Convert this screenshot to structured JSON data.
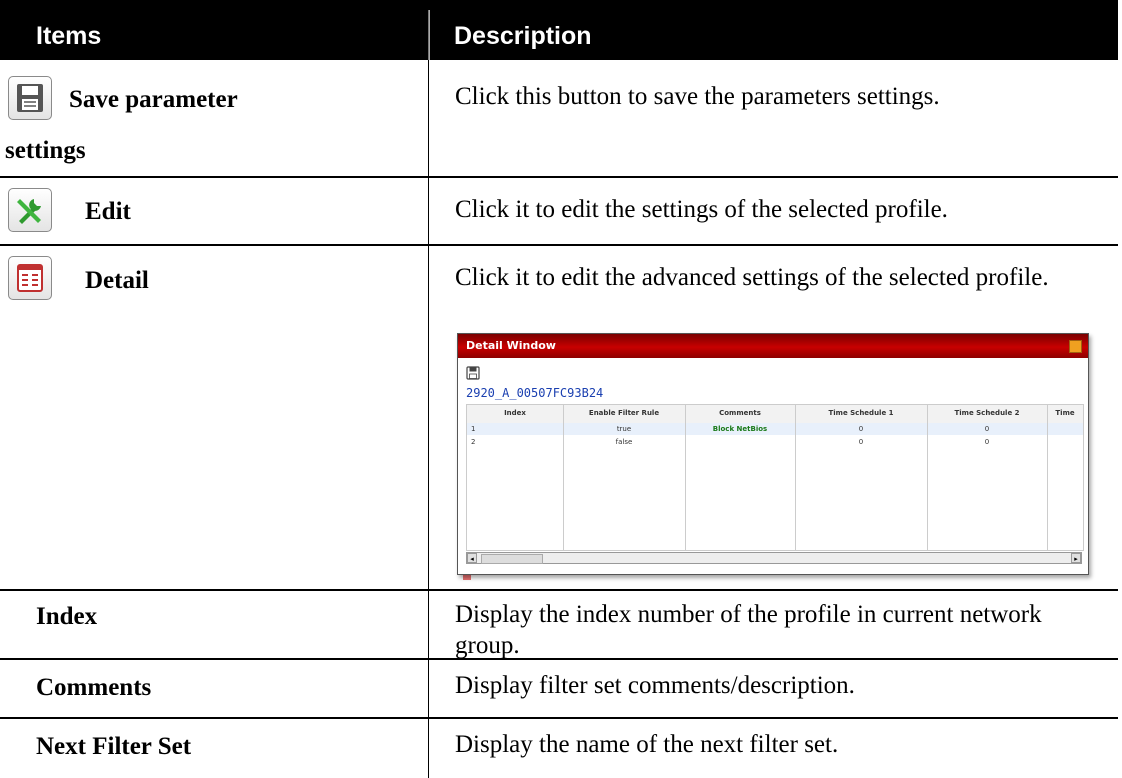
{
  "header": {
    "items": "Items",
    "description": "Description"
  },
  "rows": [
    {
      "item_line1": "Save parameter",
      "item_line2": "settings",
      "icon": "save-disk-icon",
      "desc": "Click this button to save the parameters settings."
    },
    {
      "item": "Edit",
      "icon": "tools-icon",
      "desc": "Click it to edit the settings of the selected profile."
    },
    {
      "item": "Detail",
      "icon": "detail-list-icon",
      "desc": "Click it to edit the advanced settings of the selected profile."
    },
    {
      "item": "Index",
      "desc": "Display the index number of the profile in current network group."
    },
    {
      "item": "Comments",
      "desc": "Display filter set comments/description."
    },
    {
      "item": "Next Filter Set",
      "desc": "Display the name of the next filter set."
    }
  ],
  "detail_window": {
    "title": "Detail Window",
    "profile_id": "2920_A_00507FC93B24",
    "columns": [
      "Index",
      "Enable Filter Rule",
      "Comments",
      "Time Schedule 1",
      "Time Schedule 2",
      "Time"
    ],
    "rows": [
      [
        "1",
        "true",
        "Block NetBios",
        "0",
        "0",
        ""
      ],
      [
        "2",
        "false",
        "",
        "0",
        "0",
        ""
      ]
    ]
  },
  "colors": {
    "header_bg": "#000000",
    "window_title_bg": "#c80000",
    "edit_icon": "#2e9a2e",
    "detail_icon": "#c03030"
  }
}
